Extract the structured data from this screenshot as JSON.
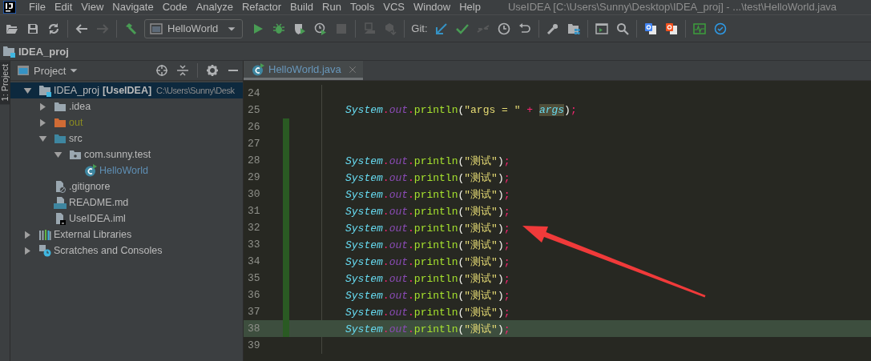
{
  "menu_bar": {
    "items": [
      "File",
      "Edit",
      "View",
      "Navigate",
      "Code",
      "Analyze",
      "Refactor",
      "Build",
      "Run",
      "Tools",
      "VCS",
      "Window",
      "Help"
    ],
    "title": "UseIDEA [C:\\Users\\Sunny\\Desktop\\IDEA_proj] - ...\\test\\HelloWorld.java"
  },
  "toolbar": {
    "groups": [
      [
        {
          "kind": "open",
          "disabled": false
        },
        {
          "kind": "save",
          "disabled": false
        },
        {
          "kind": "sync",
          "disabled": false
        }
      ],
      [
        {
          "kind": "back",
          "disabled": false
        },
        {
          "kind": "forward",
          "disabled": true
        }
      ],
      [
        {
          "kind": "build",
          "disabled": false
        },
        {
          "kind": "combo",
          "label": "HelloWorld",
          "disabled": false
        },
        {
          "kind": "run",
          "disabled": false
        },
        {
          "kind": "debug",
          "disabled": false
        },
        {
          "kind": "coverage",
          "disabled": false
        },
        {
          "kind": "profile",
          "disabled": false
        },
        {
          "kind": "stop",
          "disabled": true
        }
      ],
      [
        {
          "kind": "attach",
          "disabled": true
        },
        {
          "kind": "boxes",
          "disabled": true
        }
      ],
      [
        {
          "kind": "label",
          "label": "Git:",
          "disabled": false
        },
        {
          "kind": "update",
          "disabled": false
        },
        {
          "kind": "commit",
          "disabled": false
        },
        {
          "kind": "merge",
          "disabled": true
        },
        {
          "kind": "history",
          "disabled": false
        },
        {
          "kind": "rollback",
          "disabled": false
        }
      ],
      [
        {
          "kind": "wrench",
          "disabled": false
        },
        {
          "kind": "structure",
          "disabled": false
        }
      ],
      [
        {
          "kind": "terminal",
          "disabled": false
        },
        {
          "kind": "search",
          "disabled": false
        }
      ],
      [
        {
          "kind": "translate_blue",
          "disabled": false
        },
        {
          "kind": "translate_orange",
          "disabled": false
        }
      ],
      [
        {
          "kind": "monitor",
          "disabled": false
        },
        {
          "kind": "check_circle",
          "disabled": false
        }
      ]
    ]
  },
  "nav_bar": {
    "label": "IDEA_proj"
  },
  "tool_stripe": {
    "label": "1: Project",
    "selected": true
  },
  "project_panel": {
    "title": "Project",
    "actions": [
      {
        "kind": "locate"
      },
      {
        "kind": "collapse"
      },
      {
        "kind": "settings"
      },
      {
        "kind": "hide"
      }
    ],
    "tree": [
      {
        "label": "IDEA_proj",
        "module": "[UseIDEA]",
        "path": "C:\\Users\\Sunny\\Desk",
        "kind": "project",
        "expanded": true,
        "selected": true,
        "children": [
          {
            "label": ".idea",
            "kind": "folder",
            "expanded": false,
            "selected": false
          },
          {
            "label": "out",
            "kind": "excluded",
            "expanded": false,
            "selected": false
          },
          {
            "label": "src",
            "kind": "source",
            "expanded": true,
            "selected": false,
            "children": [
              {
                "label": "com.sunny.test",
                "kind": "package",
                "expanded": true,
                "selected": false,
                "children": [
                  {
                    "label": "HelloWorld",
                    "kind": "class",
                    "selected": false
                  }
                ]
              }
            ]
          },
          {
            "label": ".gitignore",
            "kind": "ignore",
            "selected": false
          },
          {
            "label": "README.md",
            "kind": "markdown",
            "selected": false
          },
          {
            "label": "UseIDEA.iml",
            "kind": "iml",
            "selected": false
          }
        ]
      },
      {
        "label": "External Libraries",
        "kind": "libraries",
        "expanded": false,
        "selected": false
      },
      {
        "label": "Scratches and Consoles",
        "kind": "scratches",
        "expanded": false,
        "selected": false
      }
    ]
  },
  "editor": {
    "tabs": [
      {
        "label": "HelloWorld.java",
        "selected": true
      }
    ],
    "lines": [
      {
        "number": "24",
        "changed": false,
        "current": false
      },
      {
        "number": "25",
        "changed": false,
        "current": false,
        "tokens": [
          {
            "kind": "class",
            "text": "System",
            "highlighted": false
          },
          {
            "kind": "punct",
            "text": ".",
            "highlighted": false
          },
          {
            "kind": "field",
            "text": "out",
            "highlighted": false
          },
          {
            "kind": "punct",
            "text": ".",
            "highlighted": false
          },
          {
            "kind": "method",
            "text": "println",
            "highlighted": false
          },
          {
            "kind": "paren",
            "text": "(",
            "highlighted": false
          },
          {
            "kind": "string",
            "text": "\"args = \"",
            "highlighted": false
          },
          {
            "kind": "punct",
            "text": " + ",
            "highlighted": false
          },
          {
            "kind": "param",
            "text": "args",
            "highlighted": true
          },
          {
            "kind": "paren",
            "text": ")",
            "highlighted": false
          },
          {
            "kind": "punct",
            "text": ";",
            "highlighted": false
          }
        ]
      },
      {
        "number": "26",
        "changed": true,
        "current": false
      },
      {
        "number": "27",
        "changed": true,
        "current": false
      },
      {
        "number": "28",
        "changed": true,
        "current": false,
        "tokens": [
          {
            "kind": "class",
            "text": "System"
          },
          {
            "kind": "punct",
            "text": "."
          },
          {
            "kind": "field",
            "text": "out"
          },
          {
            "kind": "punct",
            "text": "."
          },
          {
            "kind": "method",
            "text": "println"
          },
          {
            "kind": "paren",
            "text": "("
          },
          {
            "kind": "string",
            "text": "\"测试\""
          },
          {
            "kind": "paren",
            "text": ")"
          },
          {
            "kind": "punct",
            "text": ";"
          }
        ]
      },
      {
        "number": "29",
        "changed": true,
        "current": false,
        "tokens": [
          {
            "kind": "class",
            "text": "System"
          },
          {
            "kind": "punct",
            "text": "."
          },
          {
            "kind": "field",
            "text": "out"
          },
          {
            "kind": "punct",
            "text": "."
          },
          {
            "kind": "method",
            "text": "println"
          },
          {
            "kind": "paren",
            "text": "("
          },
          {
            "kind": "string",
            "text": "\"测试\""
          },
          {
            "kind": "paren",
            "text": ")"
          },
          {
            "kind": "punct",
            "text": ";"
          }
        ]
      },
      {
        "number": "30",
        "changed": true,
        "current": false,
        "tokens": [
          {
            "kind": "class",
            "text": "System"
          },
          {
            "kind": "punct",
            "text": "."
          },
          {
            "kind": "field",
            "text": "out"
          },
          {
            "kind": "punct",
            "text": "."
          },
          {
            "kind": "method",
            "text": "println"
          },
          {
            "kind": "paren",
            "text": "("
          },
          {
            "kind": "string",
            "text": "\"测试\""
          },
          {
            "kind": "paren",
            "text": ")"
          },
          {
            "kind": "punct",
            "text": ";"
          }
        ]
      },
      {
        "number": "31",
        "changed": true,
        "current": false,
        "tokens": [
          {
            "kind": "class",
            "text": "System"
          },
          {
            "kind": "punct",
            "text": "."
          },
          {
            "kind": "field",
            "text": "out"
          },
          {
            "kind": "punct",
            "text": "."
          },
          {
            "kind": "method",
            "text": "println"
          },
          {
            "kind": "paren",
            "text": "("
          },
          {
            "kind": "string",
            "text": "\"测试\""
          },
          {
            "kind": "paren",
            "text": ")"
          },
          {
            "kind": "punct",
            "text": ";"
          }
        ]
      },
      {
        "number": "32",
        "changed": true,
        "current": false,
        "tokens": [
          {
            "kind": "class",
            "text": "System"
          },
          {
            "kind": "punct",
            "text": "."
          },
          {
            "kind": "field",
            "text": "out"
          },
          {
            "kind": "punct",
            "text": "."
          },
          {
            "kind": "method",
            "text": "println"
          },
          {
            "kind": "paren",
            "text": "("
          },
          {
            "kind": "string",
            "text": "\"测试\""
          },
          {
            "kind": "paren",
            "text": ")"
          },
          {
            "kind": "punct",
            "text": ";"
          }
        ]
      },
      {
        "number": "33",
        "changed": true,
        "current": false,
        "tokens": [
          {
            "kind": "class",
            "text": "System"
          },
          {
            "kind": "punct",
            "text": "."
          },
          {
            "kind": "field",
            "text": "out"
          },
          {
            "kind": "punct",
            "text": "."
          },
          {
            "kind": "method",
            "text": "println"
          },
          {
            "kind": "paren",
            "text": "("
          },
          {
            "kind": "string",
            "text": "\"测试\""
          },
          {
            "kind": "paren",
            "text": ")"
          },
          {
            "kind": "punct",
            "text": ";"
          }
        ]
      },
      {
        "number": "34",
        "changed": true,
        "current": false,
        "tokens": [
          {
            "kind": "class",
            "text": "System"
          },
          {
            "kind": "punct",
            "text": "."
          },
          {
            "kind": "field",
            "text": "out"
          },
          {
            "kind": "punct",
            "text": "."
          },
          {
            "kind": "method",
            "text": "println"
          },
          {
            "kind": "paren",
            "text": "("
          },
          {
            "kind": "string",
            "text": "\"测试\""
          },
          {
            "kind": "paren",
            "text": ")"
          },
          {
            "kind": "punct",
            "text": ";"
          }
        ]
      },
      {
        "number": "35",
        "changed": true,
        "current": false,
        "tokens": [
          {
            "kind": "class",
            "text": "System"
          },
          {
            "kind": "punct",
            "text": "."
          },
          {
            "kind": "field",
            "text": "out"
          },
          {
            "kind": "punct",
            "text": "."
          },
          {
            "kind": "method",
            "text": "println"
          },
          {
            "kind": "paren",
            "text": "("
          },
          {
            "kind": "string",
            "text": "\"测试\""
          },
          {
            "kind": "paren",
            "text": ")"
          },
          {
            "kind": "punct",
            "text": ";"
          }
        ]
      },
      {
        "number": "36",
        "changed": true,
        "current": false,
        "tokens": [
          {
            "kind": "class",
            "text": "System"
          },
          {
            "kind": "punct",
            "text": "."
          },
          {
            "kind": "field",
            "text": "out"
          },
          {
            "kind": "punct",
            "text": "."
          },
          {
            "kind": "method",
            "text": "println"
          },
          {
            "kind": "paren",
            "text": "("
          },
          {
            "kind": "string",
            "text": "\"测试\""
          },
          {
            "kind": "paren",
            "text": ")"
          },
          {
            "kind": "punct",
            "text": ";"
          }
        ]
      },
      {
        "number": "37",
        "changed": true,
        "current": false,
        "tokens": [
          {
            "kind": "class",
            "text": "System"
          },
          {
            "kind": "punct",
            "text": "."
          },
          {
            "kind": "field",
            "text": "out"
          },
          {
            "kind": "punct",
            "text": "."
          },
          {
            "kind": "method",
            "text": "println"
          },
          {
            "kind": "paren",
            "text": "("
          },
          {
            "kind": "string",
            "text": "\"测试\""
          },
          {
            "kind": "paren",
            "text": ")"
          },
          {
            "kind": "punct",
            "text": ";"
          }
        ]
      },
      {
        "number": "38",
        "changed": true,
        "current": true,
        "tokens": [
          {
            "kind": "class",
            "text": "System"
          },
          {
            "kind": "punct",
            "text": "."
          },
          {
            "kind": "field",
            "text": "out"
          },
          {
            "kind": "punct",
            "text": "."
          },
          {
            "kind": "method",
            "text": "println"
          },
          {
            "kind": "paren",
            "text": "("
          },
          {
            "kind": "string",
            "text": "\"测试\""
          },
          {
            "kind": "paren",
            "text": ")"
          },
          {
            "kind": "punct",
            "text": ";"
          }
        ]
      },
      {
        "number": "39",
        "changed": false,
        "current": false
      }
    ]
  },
  "annotation": {
    "kind": "arrow"
  }
}
